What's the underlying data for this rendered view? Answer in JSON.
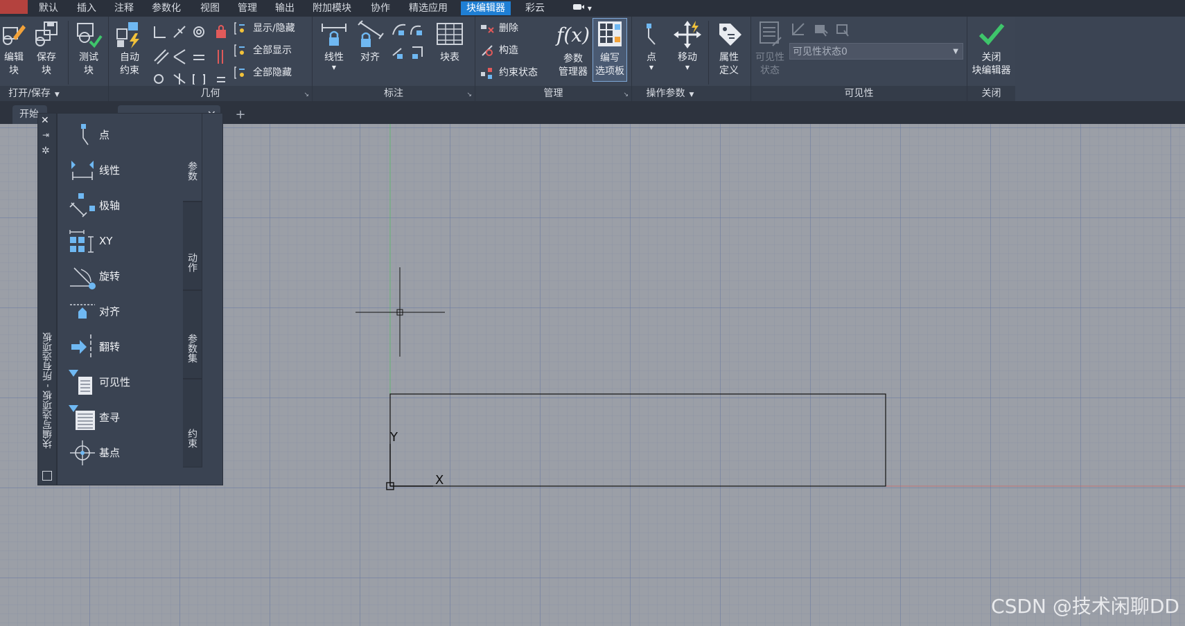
{
  "menu": {
    "tabs": [
      "默认",
      "插入",
      "注释",
      "参数化",
      "视图",
      "管理",
      "输出",
      "附加模块",
      "协作",
      "精选应用",
      "块编辑器",
      "彩云"
    ],
    "active_index": 10
  },
  "ribbon": {
    "open_save": {
      "title": "打开/保存",
      "edit_block": [
        "编辑",
        "块"
      ],
      "save_block": [
        "保存",
        "块"
      ]
    },
    "test": {
      "test_block": [
        "测试",
        "块"
      ]
    },
    "geometry": {
      "title": "几何",
      "auto_constrain": [
        "自动",
        "约束"
      ],
      "show_hide": "显示/隐藏",
      "show_all": "全部显示",
      "hide_all": "全部隐藏"
    },
    "dimension": {
      "title": "标注",
      "linear": "线性",
      "aligned": "对齐",
      "block_table": "块表"
    },
    "manage": {
      "title": "管理",
      "delete": "删除",
      "construct": "构造",
      "constraint_status": "约束状态",
      "param_manager": [
        "参数",
        "管理器"
      ],
      "authoring_palette": [
        "编写",
        "选项板"
      ],
      "fx": "f(x)"
    },
    "action_params": {
      "title": "操作参数",
      "point": "点",
      "move": "移动"
    },
    "attr": {
      "attr_def": [
        "属性",
        "定义"
      ]
    },
    "visibility": {
      "title": "可见性",
      "vis_state_btn": [
        "可见性",
        "状态"
      ],
      "state_value": "可见性状态0"
    },
    "close": {
      "title": "关闭",
      "close_editor": [
        "关闭",
        "块编辑器"
      ]
    }
  },
  "tabstrip": {
    "start_tab": "开始"
  },
  "palette": {
    "title": "块编写选项板 - 所有选项板",
    "items": [
      "点",
      "线性",
      "极轴",
      "XY",
      "旋转",
      "对齐",
      "翻转",
      "可见性",
      "查寻",
      "基点"
    ],
    "side_tabs": [
      "参数",
      "动作",
      "参数集",
      "约束"
    ]
  },
  "canvas": {
    "ucs_x": "X",
    "ucs_y": "Y"
  },
  "watermark": "CSDN @技术闲聊DD",
  "colors": {
    "accent": "#1f7fd4",
    "check": "#3ec56b",
    "icon_blue": "#6fb8f2"
  }
}
